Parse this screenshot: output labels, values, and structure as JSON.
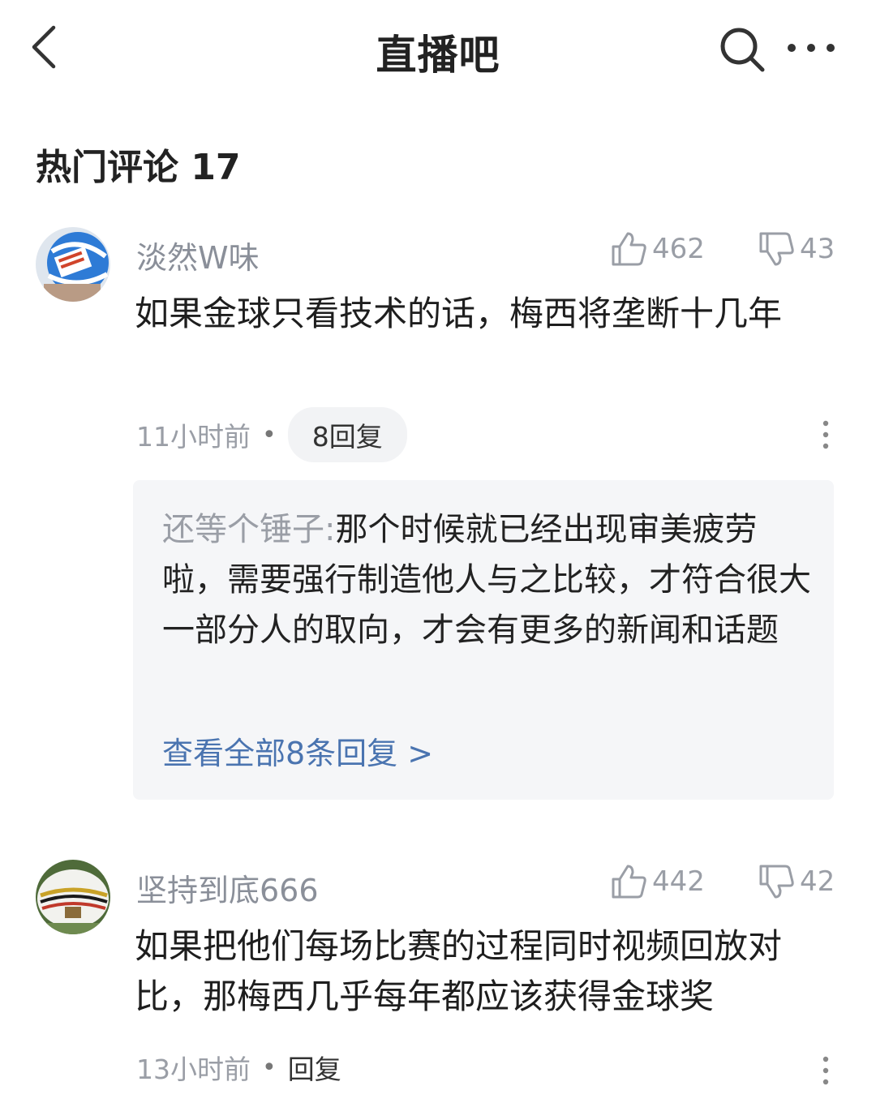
{
  "header": {
    "back_icon": "chevron-left-icon",
    "title": "直播吧",
    "search_icon": "search-icon",
    "more_icon": "more-horizontal-icon"
  },
  "section": {
    "title": "热门评论 17"
  },
  "comments": [
    {
      "username": "淡然W味",
      "likes": "462",
      "dislikes": "43",
      "text": "如果金球只看技术的话，梅西将垄断十几年",
      "time": "11小时前",
      "reply_label": "8回复",
      "reply": {
        "author": "还等个锤子:",
        "text": "那个时候就已经出现审美疲劳啦，需要强行制造他人与之比较，才符合很大一部分人的取向，才会有更多的新闻和话题",
        "view_all": "查看全部8条回复 >"
      }
    },
    {
      "username": "坚持到底666",
      "likes": "442",
      "dislikes": "42",
      "text": "如果把他们每场比赛的过程同时视频回放对比，那梅西几乎每年都应该获得金球奖",
      "time": "13小时前",
      "reply_label": "回复"
    }
  ],
  "colors": {
    "link": "#4a74b0",
    "muted": "#9a9ea6",
    "reply_bg": "#f5f6f8"
  }
}
